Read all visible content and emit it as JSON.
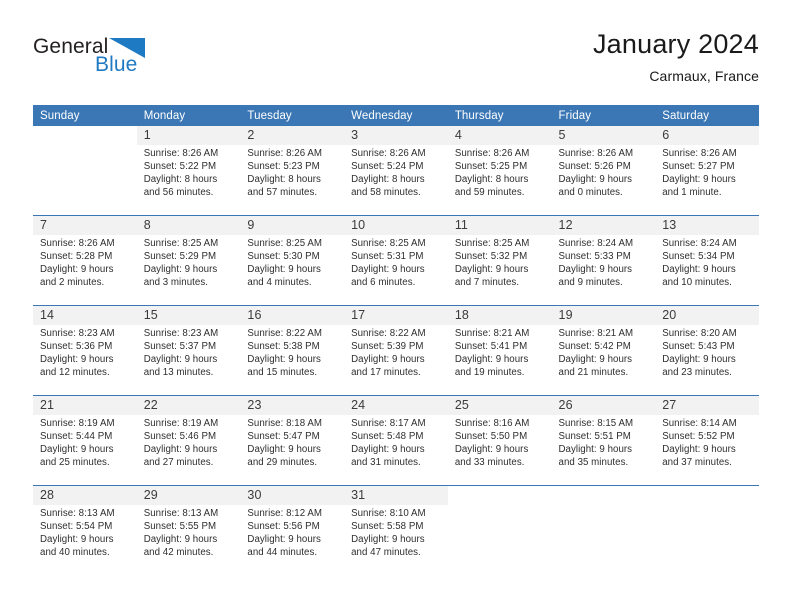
{
  "brand": {
    "name_part1": "General",
    "name_part2": "Blue",
    "triangle_color": "#1f7ac4"
  },
  "header": {
    "title": "January 2024",
    "subtitle": "Carmaux, France"
  },
  "theme": {
    "header_row_bg": "#3b77b5",
    "daynum_bg": "#f2f2f2",
    "separator": "#3b77b5",
    "text": "#2e2e2e"
  },
  "weekdays": [
    "Sunday",
    "Monday",
    "Tuesday",
    "Wednesday",
    "Thursday",
    "Friday",
    "Saturday"
  ],
  "weeks": [
    {
      "days": [
        {
          "num": "",
          "sunrise": "",
          "sunset": "",
          "daylight1": "",
          "daylight2": ""
        },
        {
          "num": "1",
          "sunrise": "Sunrise: 8:26 AM",
          "sunset": "Sunset: 5:22 PM",
          "daylight1": "Daylight: 8 hours",
          "daylight2": "and 56 minutes."
        },
        {
          "num": "2",
          "sunrise": "Sunrise: 8:26 AM",
          "sunset": "Sunset: 5:23 PM",
          "daylight1": "Daylight: 8 hours",
          "daylight2": "and 57 minutes."
        },
        {
          "num": "3",
          "sunrise": "Sunrise: 8:26 AM",
          "sunset": "Sunset: 5:24 PM",
          "daylight1": "Daylight: 8 hours",
          "daylight2": "and 58 minutes."
        },
        {
          "num": "4",
          "sunrise": "Sunrise: 8:26 AM",
          "sunset": "Sunset: 5:25 PM",
          "daylight1": "Daylight: 8 hours",
          "daylight2": "and 59 minutes."
        },
        {
          "num": "5",
          "sunrise": "Sunrise: 8:26 AM",
          "sunset": "Sunset: 5:26 PM",
          "daylight1": "Daylight: 9 hours",
          "daylight2": "and 0 minutes."
        },
        {
          "num": "6",
          "sunrise": "Sunrise: 8:26 AM",
          "sunset": "Sunset: 5:27 PM",
          "daylight1": "Daylight: 9 hours",
          "daylight2": "and 1 minute."
        }
      ]
    },
    {
      "days": [
        {
          "num": "7",
          "sunrise": "Sunrise: 8:26 AM",
          "sunset": "Sunset: 5:28 PM",
          "daylight1": "Daylight: 9 hours",
          "daylight2": "and 2 minutes."
        },
        {
          "num": "8",
          "sunrise": "Sunrise: 8:25 AM",
          "sunset": "Sunset: 5:29 PM",
          "daylight1": "Daylight: 9 hours",
          "daylight2": "and 3 minutes."
        },
        {
          "num": "9",
          "sunrise": "Sunrise: 8:25 AM",
          "sunset": "Sunset: 5:30 PM",
          "daylight1": "Daylight: 9 hours",
          "daylight2": "and 4 minutes."
        },
        {
          "num": "10",
          "sunrise": "Sunrise: 8:25 AM",
          "sunset": "Sunset: 5:31 PM",
          "daylight1": "Daylight: 9 hours",
          "daylight2": "and 6 minutes."
        },
        {
          "num": "11",
          "sunrise": "Sunrise: 8:25 AM",
          "sunset": "Sunset: 5:32 PM",
          "daylight1": "Daylight: 9 hours",
          "daylight2": "and 7 minutes."
        },
        {
          "num": "12",
          "sunrise": "Sunrise: 8:24 AM",
          "sunset": "Sunset: 5:33 PM",
          "daylight1": "Daylight: 9 hours",
          "daylight2": "and 9 minutes."
        },
        {
          "num": "13",
          "sunrise": "Sunrise: 8:24 AM",
          "sunset": "Sunset: 5:34 PM",
          "daylight1": "Daylight: 9 hours",
          "daylight2": "and 10 minutes."
        }
      ]
    },
    {
      "days": [
        {
          "num": "14",
          "sunrise": "Sunrise: 8:23 AM",
          "sunset": "Sunset: 5:36 PM",
          "daylight1": "Daylight: 9 hours",
          "daylight2": "and 12 minutes."
        },
        {
          "num": "15",
          "sunrise": "Sunrise: 8:23 AM",
          "sunset": "Sunset: 5:37 PM",
          "daylight1": "Daylight: 9 hours",
          "daylight2": "and 13 minutes."
        },
        {
          "num": "16",
          "sunrise": "Sunrise: 8:22 AM",
          "sunset": "Sunset: 5:38 PM",
          "daylight1": "Daylight: 9 hours",
          "daylight2": "and 15 minutes."
        },
        {
          "num": "17",
          "sunrise": "Sunrise: 8:22 AM",
          "sunset": "Sunset: 5:39 PM",
          "daylight1": "Daylight: 9 hours",
          "daylight2": "and 17 minutes."
        },
        {
          "num": "18",
          "sunrise": "Sunrise: 8:21 AM",
          "sunset": "Sunset: 5:41 PM",
          "daylight1": "Daylight: 9 hours",
          "daylight2": "and 19 minutes."
        },
        {
          "num": "19",
          "sunrise": "Sunrise: 8:21 AM",
          "sunset": "Sunset: 5:42 PM",
          "daylight1": "Daylight: 9 hours",
          "daylight2": "and 21 minutes."
        },
        {
          "num": "20",
          "sunrise": "Sunrise: 8:20 AM",
          "sunset": "Sunset: 5:43 PM",
          "daylight1": "Daylight: 9 hours",
          "daylight2": "and 23 minutes."
        }
      ]
    },
    {
      "days": [
        {
          "num": "21",
          "sunrise": "Sunrise: 8:19 AM",
          "sunset": "Sunset: 5:44 PM",
          "daylight1": "Daylight: 9 hours",
          "daylight2": "and 25 minutes."
        },
        {
          "num": "22",
          "sunrise": "Sunrise: 8:19 AM",
          "sunset": "Sunset: 5:46 PM",
          "daylight1": "Daylight: 9 hours",
          "daylight2": "and 27 minutes."
        },
        {
          "num": "23",
          "sunrise": "Sunrise: 8:18 AM",
          "sunset": "Sunset: 5:47 PM",
          "daylight1": "Daylight: 9 hours",
          "daylight2": "and 29 minutes."
        },
        {
          "num": "24",
          "sunrise": "Sunrise: 8:17 AM",
          "sunset": "Sunset: 5:48 PM",
          "daylight1": "Daylight: 9 hours",
          "daylight2": "and 31 minutes."
        },
        {
          "num": "25",
          "sunrise": "Sunrise: 8:16 AM",
          "sunset": "Sunset: 5:50 PM",
          "daylight1": "Daylight: 9 hours",
          "daylight2": "and 33 minutes."
        },
        {
          "num": "26",
          "sunrise": "Sunrise: 8:15 AM",
          "sunset": "Sunset: 5:51 PM",
          "daylight1": "Daylight: 9 hours",
          "daylight2": "and 35 minutes."
        },
        {
          "num": "27",
          "sunrise": "Sunrise: 8:14 AM",
          "sunset": "Sunset: 5:52 PM",
          "daylight1": "Daylight: 9 hours",
          "daylight2": "and 37 minutes."
        }
      ]
    },
    {
      "days": [
        {
          "num": "28",
          "sunrise": "Sunrise: 8:13 AM",
          "sunset": "Sunset: 5:54 PM",
          "daylight1": "Daylight: 9 hours",
          "daylight2": "and 40 minutes."
        },
        {
          "num": "29",
          "sunrise": "Sunrise: 8:13 AM",
          "sunset": "Sunset: 5:55 PM",
          "daylight1": "Daylight: 9 hours",
          "daylight2": "and 42 minutes."
        },
        {
          "num": "30",
          "sunrise": "Sunrise: 8:12 AM",
          "sunset": "Sunset: 5:56 PM",
          "daylight1": "Daylight: 9 hours",
          "daylight2": "and 44 minutes."
        },
        {
          "num": "31",
          "sunrise": "Sunrise: 8:10 AM",
          "sunset": "Sunset: 5:58 PM",
          "daylight1": "Daylight: 9 hours",
          "daylight2": "and 47 minutes."
        },
        {
          "num": "",
          "sunrise": "",
          "sunset": "",
          "daylight1": "",
          "daylight2": ""
        },
        {
          "num": "",
          "sunrise": "",
          "sunset": "",
          "daylight1": "",
          "daylight2": ""
        },
        {
          "num": "",
          "sunrise": "",
          "sunset": "",
          "daylight1": "",
          "daylight2": ""
        }
      ]
    }
  ]
}
